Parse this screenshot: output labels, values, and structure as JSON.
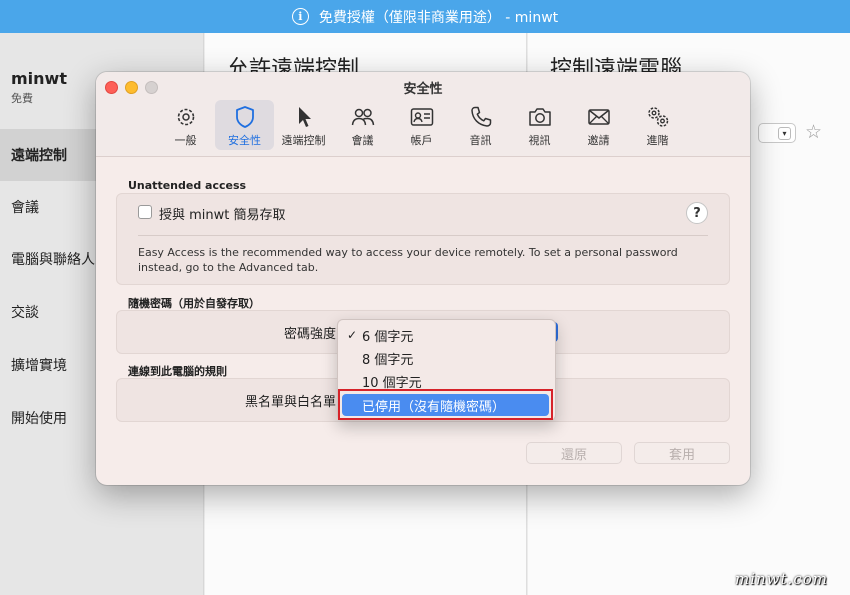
{
  "banner": {
    "text": "免費授權（僅限非商業用途） - minwt",
    "info_icon": "info-icon",
    "info_glyph": "i"
  },
  "sidebar": {
    "user_name": "minwt",
    "plan": "免費",
    "items": [
      {
        "label": "遠端控制",
        "active": true
      },
      {
        "label": "會議"
      },
      {
        "label": "電腦與聯絡人"
      },
      {
        "label": "交談"
      },
      {
        "label": "擴增實境"
      },
      {
        "label": "開始使用"
      }
    ]
  },
  "main": {
    "left_title": "允許遠端控制",
    "right_title": "控制遠端電腦"
  },
  "dialog": {
    "title": "安全性",
    "tabs": [
      {
        "label": "一般",
        "icon": "gear-icon"
      },
      {
        "label": "安全性",
        "icon": "shield-icon",
        "active": true
      },
      {
        "label": "遠端控制",
        "icon": "pointer-icon"
      },
      {
        "label": "會議",
        "icon": "people-icon"
      },
      {
        "label": "帳戶",
        "icon": "id-card-icon"
      },
      {
        "label": "音訊",
        "icon": "phone-icon"
      },
      {
        "label": "視訊",
        "icon": "camera-icon"
      },
      {
        "label": "邀請",
        "icon": "envelope-icon"
      },
      {
        "label": "進階",
        "icon": "gears-icon"
      }
    ],
    "unattended": {
      "heading": "Unattended access",
      "checkbox_label": "授與 minwt 簡易存取",
      "checked": false,
      "help": "?",
      "description": "Easy Access is the recommended way to access your device remotely. To set a personal password instead, go to the Advanced tab."
    },
    "random_password": {
      "heading": "隨機密碼（用於自發存取）",
      "strength_label": "密碼強度"
    },
    "rules": {
      "heading": "連線到此電腦的規則",
      "list_label": "黑名單與白名單"
    },
    "buttons": {
      "revert": "還原",
      "apply": "套用"
    }
  },
  "dropdown": {
    "check_mark": "✓",
    "options": [
      {
        "label": "6 個字元",
        "checked": true
      },
      {
        "label": "8 個字元"
      },
      {
        "label": "10 個字元"
      },
      {
        "label": "已停用（沒有隨機密碼）",
        "highlighted": true
      }
    ]
  },
  "watermark": "minwt.com",
  "colors": {
    "banner": "#4aa6ea",
    "accent": "#1f6fe0",
    "menu_highlight": "#4a8cf0",
    "annotation_frame": "#d6232a"
  }
}
